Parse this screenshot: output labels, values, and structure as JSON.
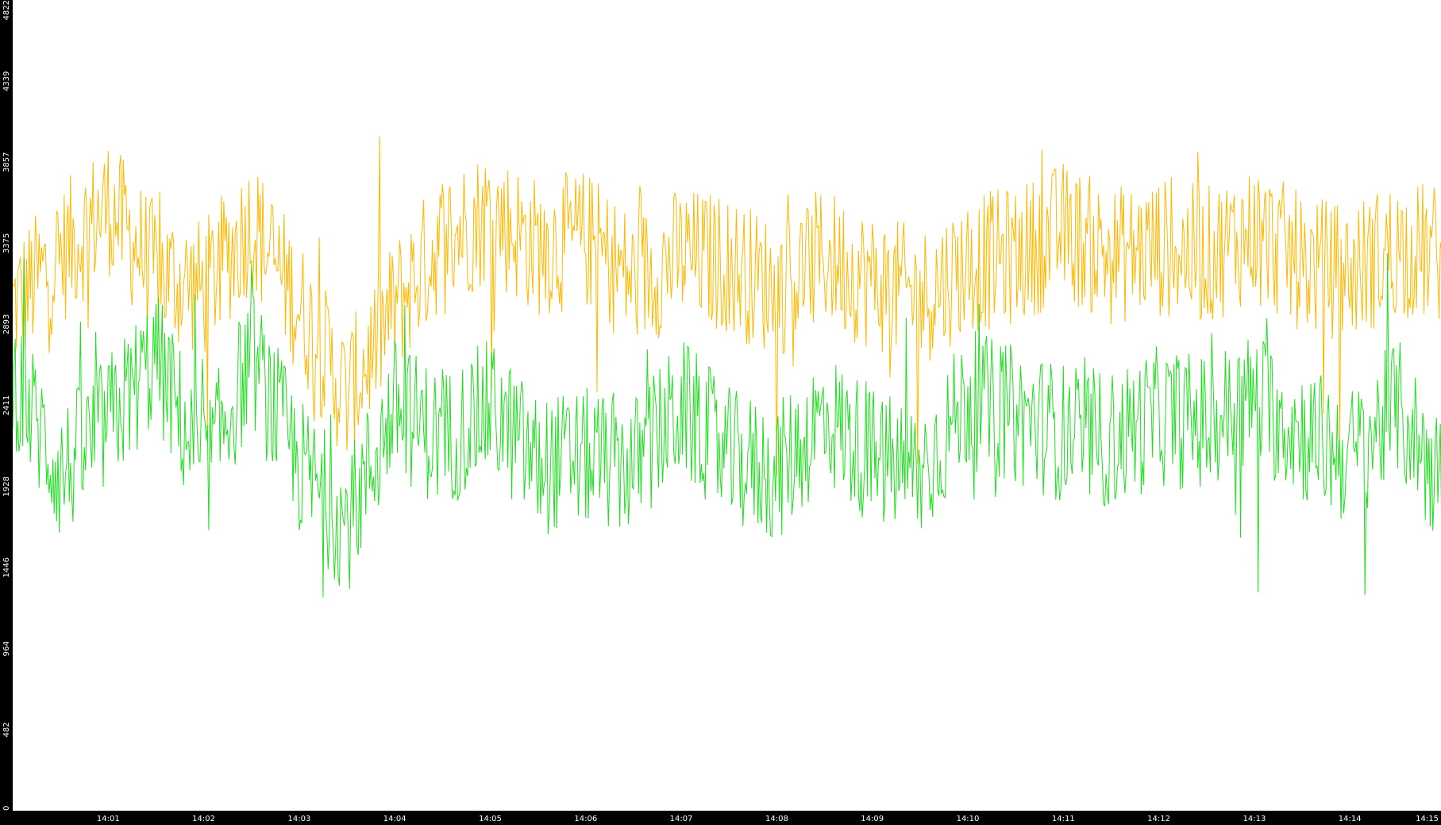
{
  "colors": {
    "background": "#ffffff",
    "axis_bar": "#000000",
    "axis_text": "#ffffff",
    "series_orange": "#ffb800",
    "series_green": "#1ee01e"
  },
  "chart_data": {
    "type": "line",
    "title": "",
    "xlabel": "",
    "ylabel": "",
    "ylim": [
      0,
      4822
    ],
    "xlim": [
      "14:00:00",
      "14:15:00"
    ],
    "x_ticks": [
      "14:01",
      "14:02",
      "14:03",
      "14:04",
      "14:05",
      "14:06",
      "14:07",
      "14:08",
      "14:09",
      "14:10",
      "14:11",
      "14:12",
      "14:13",
      "14:14",
      "14:15"
    ],
    "y_ticks": [
      0,
      482,
      964,
      1446,
      1928,
      2411,
      2893,
      3375,
      3857,
      4339,
      4822
    ],
    "grid": false,
    "sample_interval_seconds": 30,
    "x": [
      "14:00:00",
      "14:00:30",
      "14:01:00",
      "14:01:30",
      "14:02:00",
      "14:02:30",
      "14:03:00",
      "14:03:30",
      "14:04:00",
      "14:04:30",
      "14:05:00",
      "14:05:30",
      "14:06:00",
      "14:06:30",
      "14:07:00",
      "14:07:30",
      "14:08:00",
      "14:08:30",
      "14:09:00",
      "14:09:30",
      "14:10:00",
      "14:10:30",
      "14:11:00",
      "14:11:30",
      "14:12:00",
      "14:12:30",
      "14:13:00",
      "14:13:30",
      "14:14:00",
      "14:14:30",
      "14:15:00"
    ],
    "series": [
      {
        "color": "#ffb800",
        "values": [
          3000,
          3300,
          3600,
          3200,
          3100,
          3500,
          3000,
          2450,
          3000,
          3400,
          3550,
          3350,
          3400,
          3150,
          3300,
          3250,
          3100,
          3300,
          3150,
          3050,
          3250,
          3300,
          3450,
          3300,
          3350,
          3300,
          3450,
          3250,
          3200,
          3350,
          3300
        ]
      },
      {
        "color": "#1ee01e",
        "values": [
          2600,
          2000,
          2300,
          2700,
          2000,
          2700,
          2050,
          1700,
          2400,
          2200,
          2400,
          2050,
          2100,
          2050,
          2400,
          2100,
          2000,
          2350,
          2100,
          2000,
          2450,
          2350,
          2250,
          2200,
          2350,
          2300,
          2450,
          2250,
          2100,
          2400,
          1900
        ]
      }
    ]
  }
}
